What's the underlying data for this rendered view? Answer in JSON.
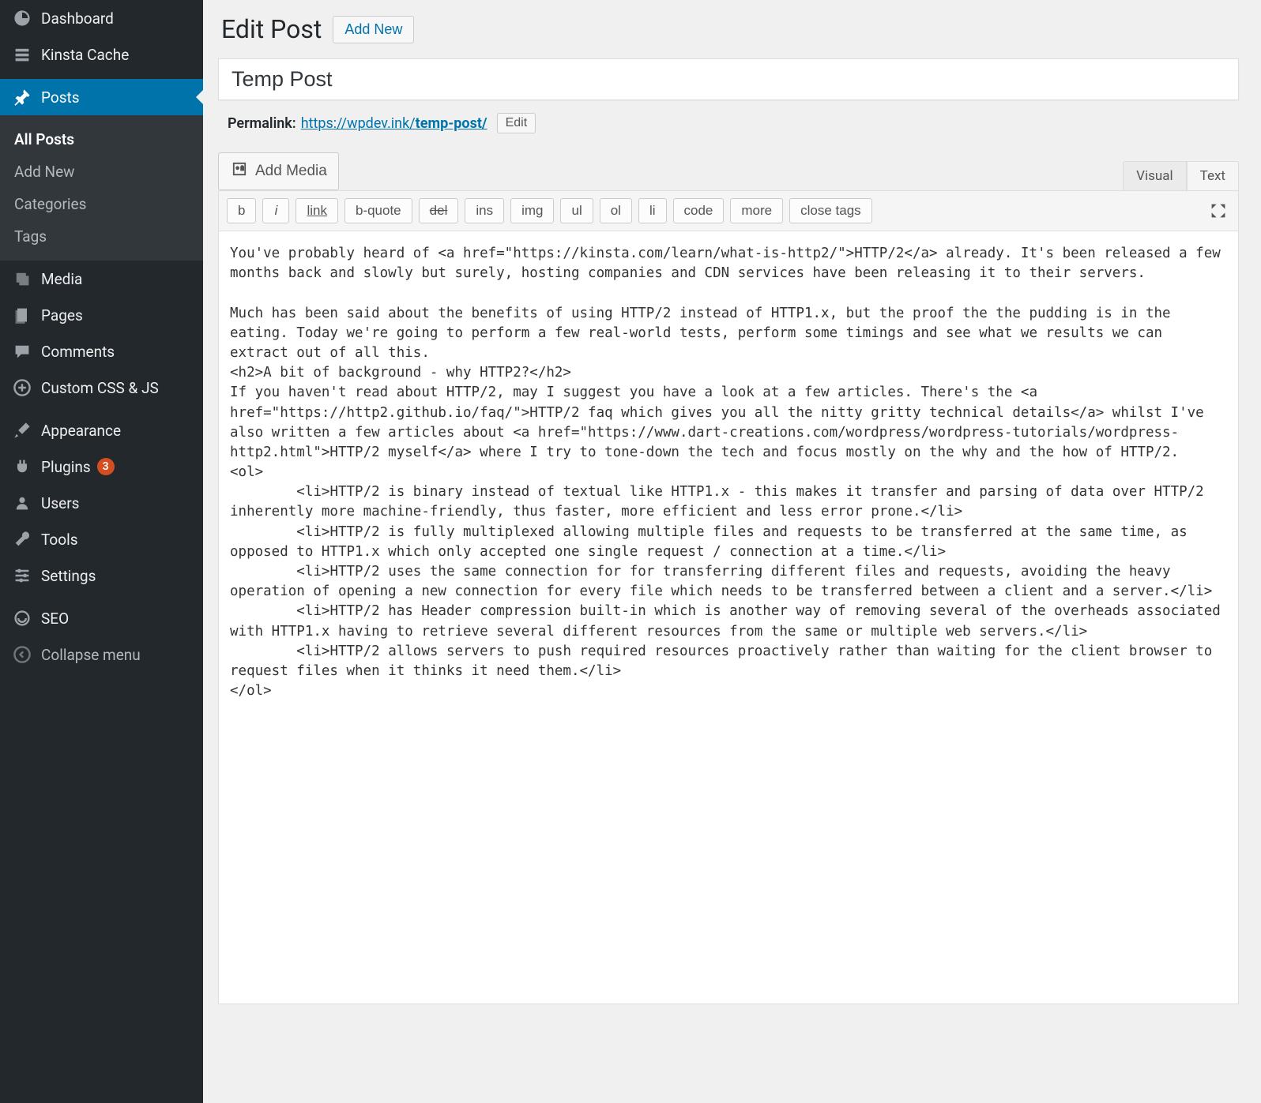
{
  "sidebar": {
    "items": [
      {
        "label": "Dashboard",
        "icon": "dashboard-icon"
      },
      {
        "label": "Kinsta Cache",
        "icon": "cache-icon"
      },
      {
        "label": "Posts",
        "icon": "pin-icon",
        "active": true
      },
      {
        "label": "Media",
        "icon": "media-icon"
      },
      {
        "label": "Pages",
        "icon": "pages-icon"
      },
      {
        "label": "Comments",
        "icon": "comment-icon"
      },
      {
        "label": "Custom CSS & JS",
        "icon": "plus-icon"
      },
      {
        "label": "Appearance",
        "icon": "brush-icon"
      },
      {
        "label": "Plugins",
        "icon": "plug-icon",
        "badge": "3"
      },
      {
        "label": "Users",
        "icon": "user-icon"
      },
      {
        "label": "Tools",
        "icon": "wrench-icon"
      },
      {
        "label": "Settings",
        "icon": "sliders-icon"
      },
      {
        "label": "SEO",
        "icon": "seo-icon"
      },
      {
        "label": "Collapse menu",
        "icon": "collapse-icon"
      }
    ],
    "submenu": [
      {
        "label": "All Posts",
        "current": true
      },
      {
        "label": "Add New"
      },
      {
        "label": "Categories"
      },
      {
        "label": "Tags"
      }
    ]
  },
  "header": {
    "page_title": "Edit Post",
    "add_new": "Add New"
  },
  "post": {
    "title": "Temp Post",
    "permalink_label": "Permalink:",
    "permalink_base": "https://wpdev.ink/",
    "permalink_slug": "temp-post/",
    "edit_label": "Edit"
  },
  "media": {
    "add_media": "Add Media"
  },
  "editor": {
    "tabs": {
      "visual": "Visual",
      "text": "Text",
      "active": "text"
    },
    "quicktags": [
      "b",
      "i",
      "link",
      "b-quote",
      "del",
      "ins",
      "img",
      "ul",
      "ol",
      "li",
      "code",
      "more",
      "close tags"
    ],
    "content": "You've probably heard of <a href=\"https://kinsta.com/learn/what-is-http2/\">HTTP/2</a> already. It's been released a few months back and slowly but surely, hosting companies and CDN services have been releasing it to their servers.\n\nMuch has been said about the benefits of using HTTP/2 instead of HTTP1.x, but the proof the the pudding is in the eating. Today we're going to perform a few real-world tests, perform some timings and see what we results we can extract out of all this.\n<h2>A bit of background - why HTTP2?</h2>\nIf you haven't read about HTTP/2, may I suggest you have a look at a few articles. There's the <a href=\"https://http2.github.io/faq/\">HTTP/2 faq which gives you all the nitty gritty technical details</a> whilst I've also written a few articles about <a href=\"https://www.dart-creations.com/wordpress/wordpress-tutorials/wordpress-http2.html\">HTTP/2 myself</a> where I try to tone-down the tech and focus mostly on the why and the how of HTTP/2.\n<ol>\n \t<li>HTTP/2 is binary instead of textual like HTTP1.x - this makes it transfer and parsing of data over HTTP/2 inherently more machine-friendly, thus faster, more efficient and less error prone.</li>\n \t<li>HTTP/2 is fully multiplexed allowing multiple files and requests to be transferred at the same time, as opposed to HTTP1.x which only accepted one single request / connection at a time.</li>\n \t<li>HTTP/2 uses the same connection for for transferring different files and requests, avoiding the heavy operation of opening a new connection for every file which needs to be transferred between a client and a server.</li>\n \t<li>HTTP/2 has Header compression built-in which is another way of removing several of the overheads associated with HTTP1.x having to retrieve several different resources from the same or multiple web servers.</li>\n \t<li>HTTP/2 allows servers to push required resources proactively rather than waiting for the client browser to request files when it thinks it need them.</li>\n</ol>"
  }
}
